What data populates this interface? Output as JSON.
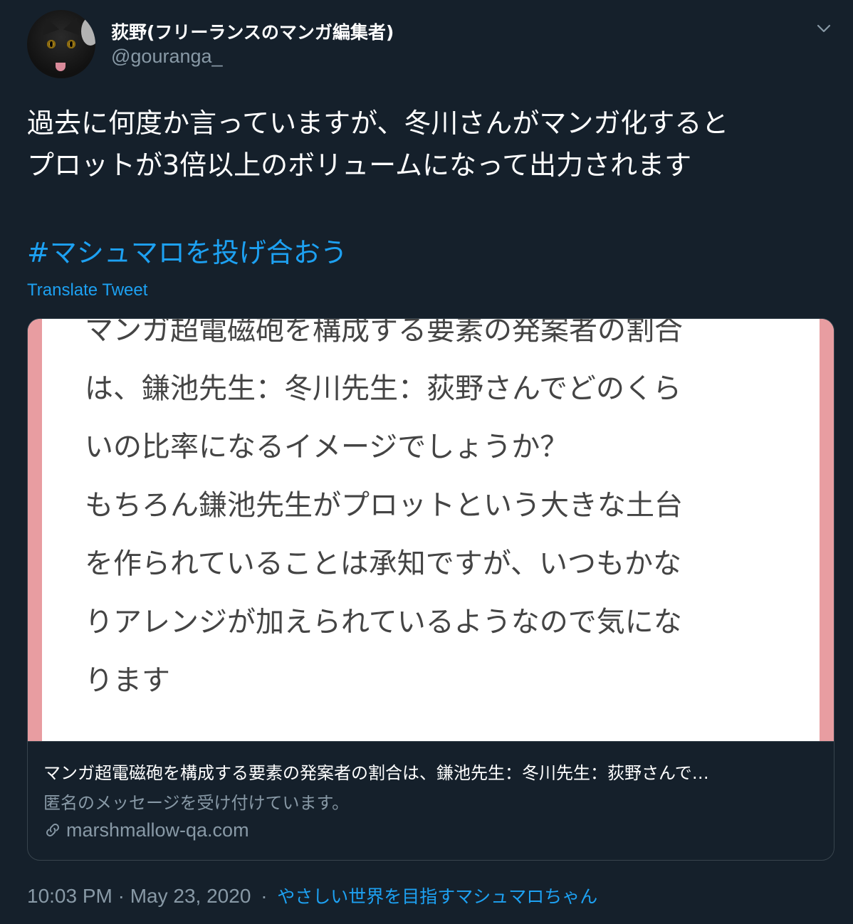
{
  "author": {
    "display_name": "荻野(フリーランスのマンガ編集者)",
    "handle": "@gouranga_"
  },
  "tweet": {
    "text_lines": [
      "過去に何度か言っていますが、冬川さんがマンガ化すると",
      "プロットが3倍以上のボリュームになって出力されます"
    ],
    "hashtag": "#マシュマロを投げ合おう",
    "translate_label": "Translate Tweet"
  },
  "card": {
    "image_text_lines": [
      "マンガ超電磁砲を構成する要素の発案者の割合",
      "は、鎌池先生：冬川先生：荻野さんでどのくら",
      "いの比率になるイメージでしょうか？",
      "もちろん鎌池先生がプロットという大きな土台",
      "を作られていることは承知ですが、いつもかな",
      "りアレンジが加えられているようなので気にな",
      "ります"
    ],
    "title": "マンガ超電磁砲を構成する要素の発案者の割合は、鎌池先生：冬川先生：荻野さんで…",
    "description": "匿名のメッセージを受け付けています。",
    "domain": "marshmallow-qa.com"
  },
  "meta": {
    "timestamp": "10:03 PM · May 23, 2020",
    "separator": "·",
    "source": "やさしい世界を目指すマシュマロちゃん"
  },
  "colors": {
    "background": "#15202b",
    "link": "#1da1f2",
    "secondary_text": "#8899a6",
    "border": "#38444d",
    "card_accent": "#e89da1"
  },
  "icons": [
    "caret-down-icon",
    "link-icon"
  ]
}
